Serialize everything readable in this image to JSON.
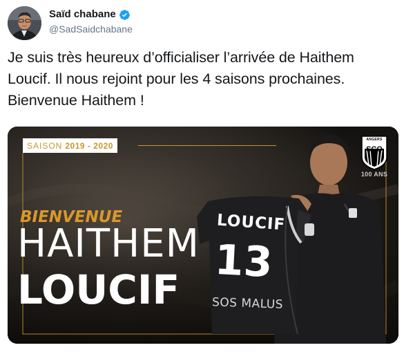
{
  "tweet": {
    "author": {
      "display_name": "Saïd chabane",
      "handle": "@SadSaidchabane",
      "verified": true,
      "verified_color": "#1da1f2"
    },
    "text": "Je suis très heureux d’officialiser l’arrivée de Haithem\nLoucif. Il nous rejoint pour les 4 saisons prochaines.\nBienvenue Haithem !",
    "media": {
      "season_label": "SAISON",
      "season_years": "2019 - 2020",
      "welcome": "BIENVENUE",
      "first_name": "HAITHEM",
      "last_name": "LOUCIF",
      "shirt_name": "LOUCIF",
      "shirt_number": "13",
      "shirt_sponsor": "SOS MALUS",
      "club_top": "ANGERS",
      "club_abbr": "SCO",
      "club_anniversary": "100 ANS",
      "accent_color": "#c8962a"
    }
  }
}
